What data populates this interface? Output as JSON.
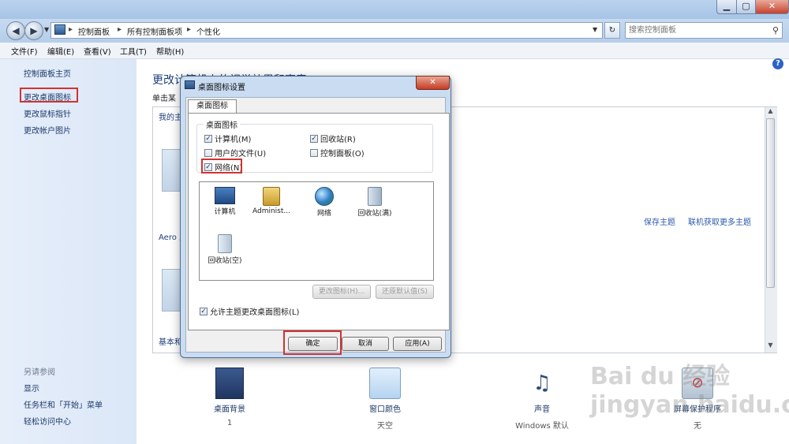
{
  "address_bar": {
    "segments": [
      "控制面板",
      "所有控制面板项",
      "个性化"
    ],
    "search_placeholder": "搜索控制面板"
  },
  "menu": [
    "文件(F)",
    "编辑(E)",
    "查看(V)",
    "工具(T)",
    "帮助(H)"
  ],
  "left_pane": {
    "links": [
      "控制面板主页",
      "更改桌面图标",
      "更改鼠标指针",
      "更改帐户图片"
    ],
    "see_also_title": "另请参阅",
    "see_also": [
      "显示",
      "任务栏和「开始」菜单",
      "轻松访问中心"
    ]
  },
  "main": {
    "title": "更改计算机上的视觉效果和声音",
    "subtitle": "单击某",
    "my_themes": "我的主",
    "aero_themes": "Aero 主",
    "basic_themes": "基本和",
    "save_theme": "保存主题",
    "more_themes": "联机获取更多主题",
    "bottom": [
      {
        "label": "桌面背景",
        "value": "1"
      },
      {
        "label": "窗口颜色",
        "value": "天空"
      },
      {
        "label": "声音",
        "value": "Windows 默认"
      },
      {
        "label": "屏幕保护程序",
        "value": "无"
      }
    ]
  },
  "dialog": {
    "title": "桌面图标设置",
    "close": "✕",
    "tab": "桌面图标",
    "group_title": "桌面图标",
    "checkboxes": [
      {
        "label": "计算机(M)",
        "checked": true
      },
      {
        "label": "回收站(R)",
        "checked": true
      },
      {
        "label": "用户的文件(U)",
        "checked": false
      },
      {
        "label": "控制面板(O)",
        "checked": false
      },
      {
        "label": "网络(N)",
        "checked": true
      }
    ],
    "icons": [
      "计算机",
      "Administ...",
      "网络",
      "回收站(满)",
      "回收站(空)"
    ],
    "change_icon": "更改图标(H)...",
    "restore_default": "还原默认值(S)",
    "allow_themes": "允许主题更改桌面图标(L)",
    "allow_themes_checked": true,
    "ok": "确定",
    "cancel": "取消",
    "apply": "应用(A)"
  },
  "watermark": "Bai du 经验 jingyan.baidu.com",
  "colors": {
    "highlight_red": "#d23232",
    "link_blue": "#2b5bab",
    "dialog_frame": "#c9dcf1"
  }
}
